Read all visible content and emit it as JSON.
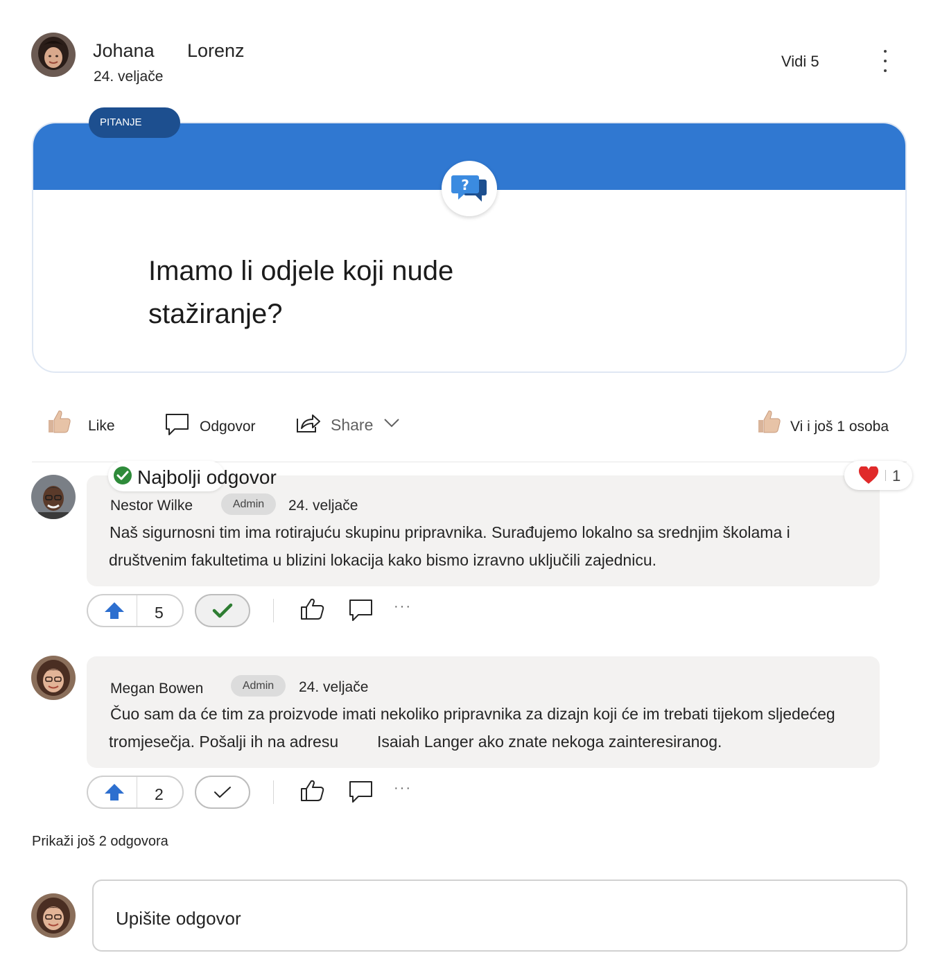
{
  "post": {
    "author_first": "Johana",
    "author_last": "Lorenz",
    "date": "24. veljače",
    "seen_by": "Vidi 5",
    "tag": "PITANJE",
    "question": "Imamo li odjele koji nude stažiranje?"
  },
  "actions": {
    "like": "Like",
    "reply": "Odgovor",
    "share": "Share",
    "liked_by": "Vi i još 1 osoba"
  },
  "replies": [
    {
      "best_answer_label": "Najbolji odgovor",
      "name": "Nestor Wilke",
      "role": "Admin",
      "date": "24. veljače",
      "text_line1": "Naš sigurnosni tim ima rotirajuću skupinu pripravnika. Surađujemo lokalno sa srednjim školama i",
      "text_line2": "društvenim fakultetima u blizini lokacija kako bismo izravno uključili zajednicu.",
      "reaction_count": "1",
      "upvotes": "5",
      "accepted": true
    },
    {
      "name": "Megan Bowen",
      "role": "Admin",
      "date": "24. veljače",
      "text_line1": "Čuo sam da će tim za proizvode imati nekoliko pripravnika za dizajn koji će im trebati tijekom sljedećeg",
      "text_line2a": "tromjesečja. Pošalji ih na adresu",
      "text_line2b": "Isaiah Langer ako znate nekoga zainteresiranog.",
      "upvotes": "2",
      "accepted": false
    }
  ],
  "show_more": "Prikaži još 2 odgovora",
  "composer": {
    "placeholder": "Upišite odgovor"
  },
  "colors": {
    "brand_blue": "#3078d1",
    "tag_blue": "#1d4f8f",
    "accept_green": "#2e7d32",
    "heart_red": "#e02a2a"
  }
}
